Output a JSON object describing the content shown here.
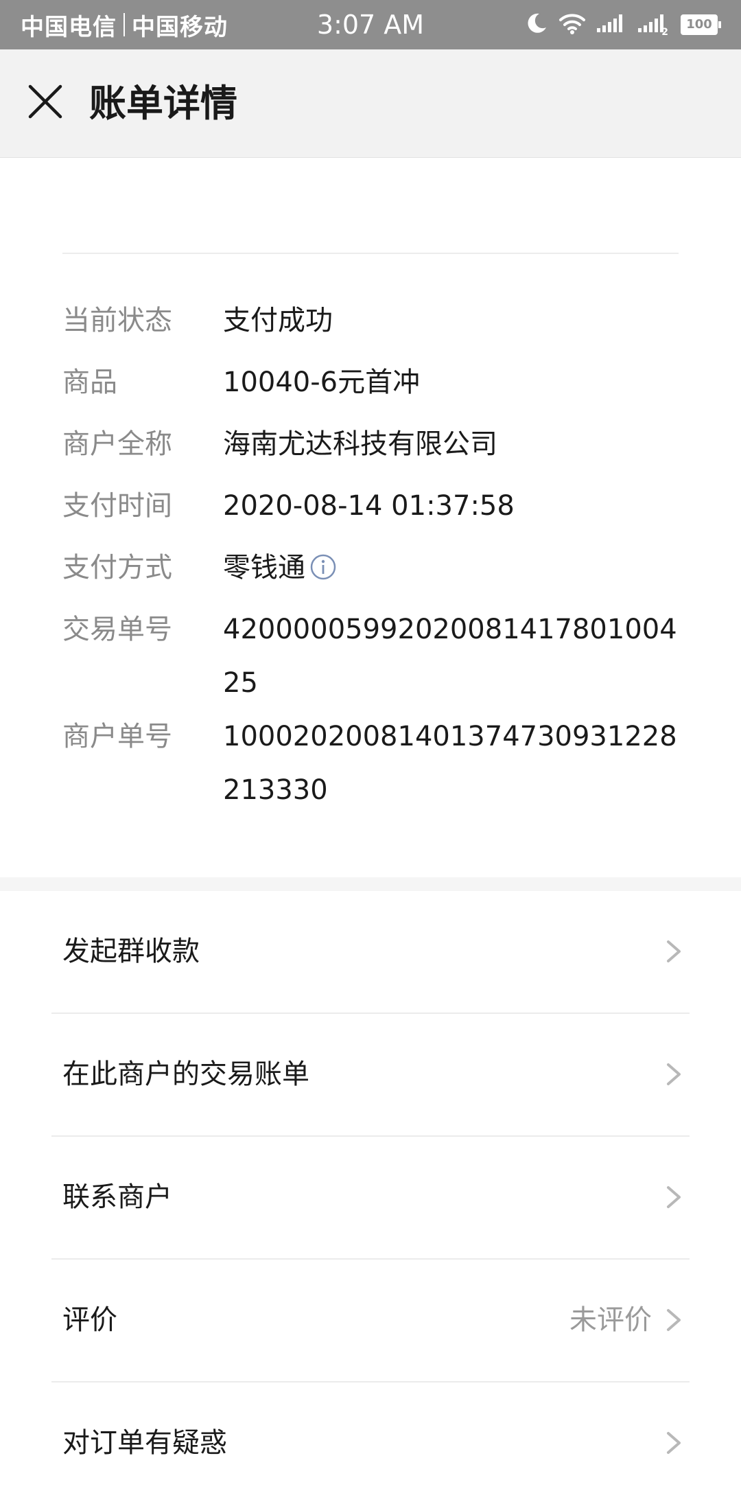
{
  "status_bar": {
    "carrier_1": "中国电信",
    "carrier_2": "中国移动",
    "time": "3:07 AM",
    "battery_level": "100",
    "sim_2_indicator": "2",
    "icons": [
      "moon-icon",
      "wifi-icon",
      "signal-icon",
      "signal-2-icon",
      "battery-icon"
    ]
  },
  "nav": {
    "close_icon": "close-icon",
    "title": "账单详情"
  },
  "details": {
    "rows": [
      {
        "label": "当前状态",
        "value": "支付成功"
      },
      {
        "label": "商品",
        "value": "10040-6元首冲"
      },
      {
        "label": "商户全称",
        "value": "海南尤达科技有限公司"
      },
      {
        "label": "支付时间",
        "value": "2020-08-14 01:37:58"
      },
      {
        "label": "支付方式",
        "value": "零钱通",
        "icon": "info-icon"
      },
      {
        "label": "交易单号",
        "value": "4200000599202008141780100425"
      },
      {
        "label": "商户单号",
        "value": "10002020081401374730931228213330"
      }
    ]
  },
  "actions": {
    "chevron_icon": "chevron-right-icon",
    "items": [
      {
        "label": "发起群收款",
        "value": ""
      },
      {
        "label": "在此商户的交易账单",
        "value": ""
      },
      {
        "label": "联系商户",
        "value": ""
      },
      {
        "label": "评价",
        "value": "未评价"
      },
      {
        "label": "对订单有疑惑",
        "value": ""
      }
    ]
  },
  "colors": {
    "status_bar_bg": "#8e8e8e",
    "nav_bg": "#f2f2f2",
    "label_gray": "#8a8a8a",
    "text_dark": "#1a1a1a",
    "info_icon": "#7a8fb5",
    "chevron": "#b8b8b8"
  }
}
